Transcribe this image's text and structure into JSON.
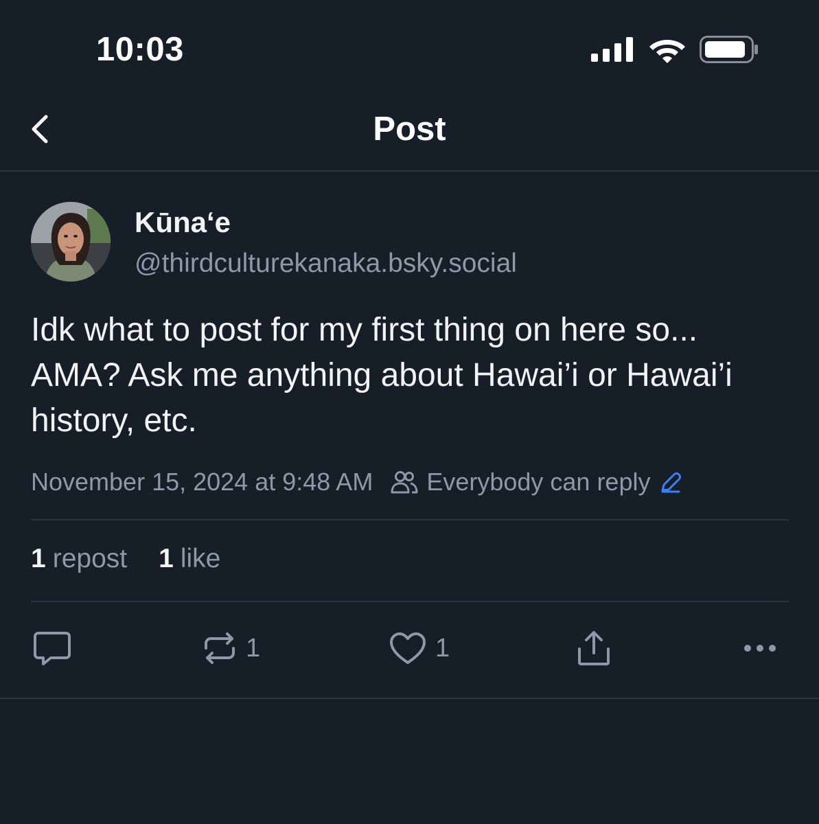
{
  "status_bar": {
    "time": "10:03"
  },
  "nav": {
    "title": "Post"
  },
  "post": {
    "author": {
      "display_name": "Kūnaʻe",
      "handle": "@thirdculturekanaka.bsky.social"
    },
    "text": "Idk what to post for my first thing on here so... AMA? Ask me anything about Hawai’i or Hawai’i history, etc.",
    "timestamp": "November 15, 2024 at 9:48 AM",
    "reply_setting": "Everybody can reply",
    "stats": {
      "reposts_num": "1",
      "reposts_label": "repost",
      "likes_num": "1",
      "likes_label": "like"
    },
    "actions": {
      "repost_count": "1",
      "like_count": "1"
    }
  },
  "colors": {
    "background": "#161e27",
    "text_primary": "#f1f3f5",
    "text_secondary": "#8d99a8",
    "divider": "#2a3543",
    "accent": "#3b82f6"
  }
}
